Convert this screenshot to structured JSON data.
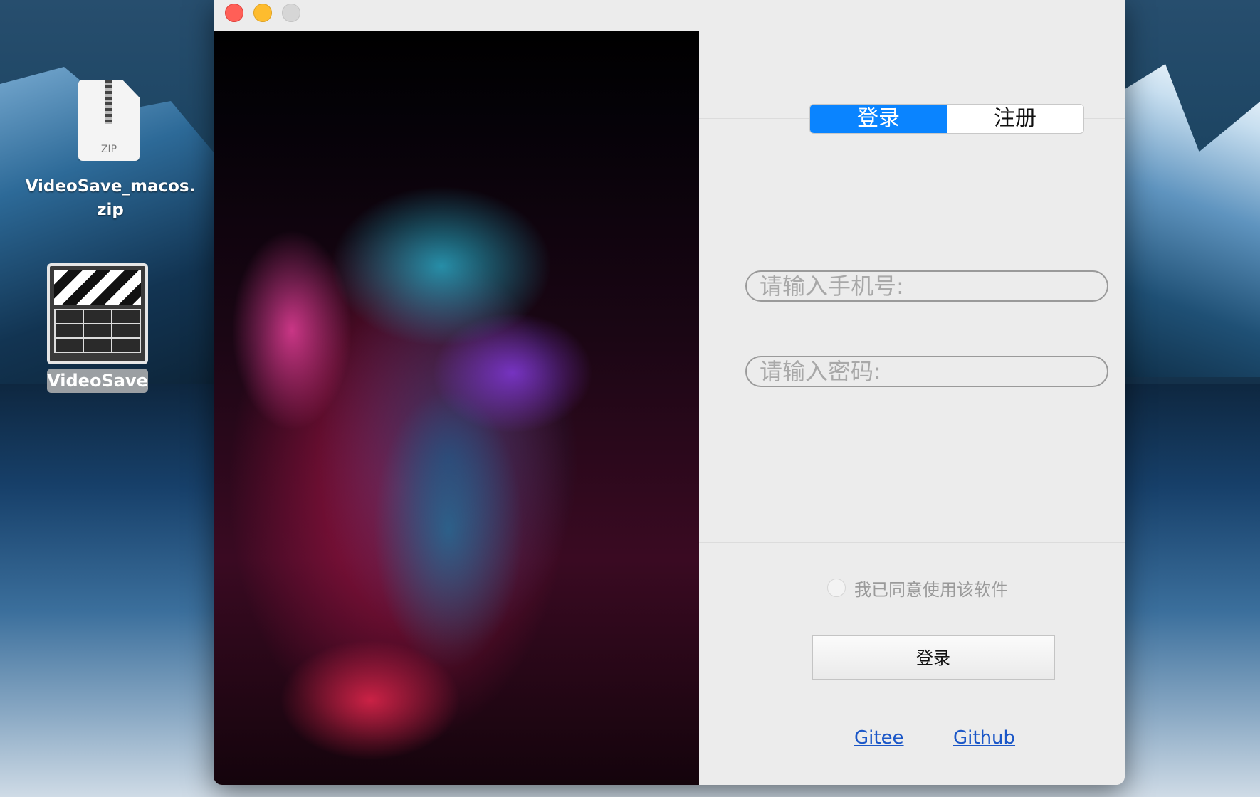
{
  "desktop": {
    "zip_file": {
      "badge": "ZIP",
      "name": "VideoSave_macos.\nzip"
    },
    "app_icon": {
      "name": "VideoSave"
    }
  },
  "window": {
    "tabs": [
      {
        "label": "登录",
        "active": true
      },
      {
        "label": "注册",
        "active": false
      }
    ],
    "phone_placeholder": "请输入手机号:",
    "password_placeholder": "请输入密码:",
    "agree_label": "我已同意使用该软件",
    "login_button": "登录",
    "links": {
      "gitee": "Gitee",
      "github": "Github"
    },
    "colors": {
      "accent": "#0a84ff",
      "link": "#1a56c7",
      "close": "#ff5f57",
      "minimize": "#febc2e"
    }
  }
}
